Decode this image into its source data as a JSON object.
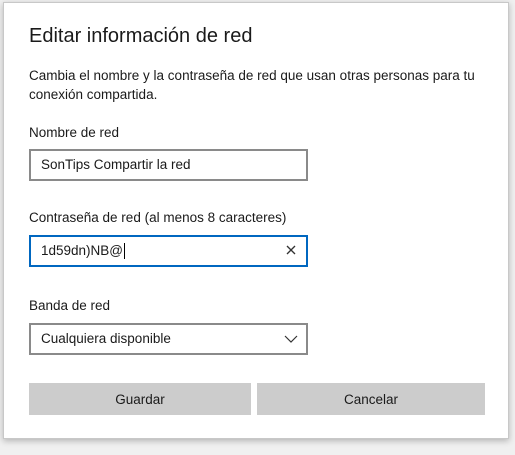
{
  "dialog": {
    "title": "Editar información de red",
    "description": "Cambia el nombre y la contraseña de red que usan otras personas para tu conexión compartida."
  },
  "network_name": {
    "label": "Nombre de red",
    "value": "SonTips Compartir la red"
  },
  "password": {
    "label": "Contraseña de red (al menos 8 caracteres)",
    "value": "1d59dn)NB@",
    "clear_icon": "close-icon"
  },
  "band": {
    "label": "Banda de red",
    "selected": "Cualquiera disponible",
    "dropdown_icon": "chevron-down-icon"
  },
  "buttons": {
    "save": "Guardar",
    "cancel": "Cancelar"
  },
  "colors": {
    "focus_border": "#0067c0",
    "field_border": "#8a8a8a",
    "button_bg": "#cccccc"
  }
}
